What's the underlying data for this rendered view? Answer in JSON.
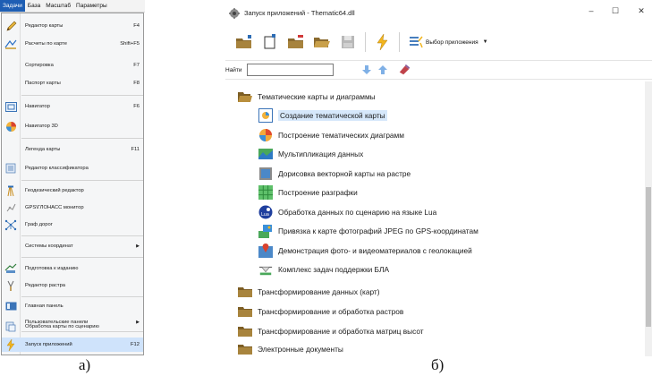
{
  "menu": {
    "menubar": [
      "Задачи",
      "База",
      "Масштаб",
      "Параметры"
    ],
    "items": [
      {
        "label": "Редактор карты",
        "shortcut": "F4",
        "icon": "pencil-icon"
      },
      {
        "label": "Расчеты по карте",
        "shortcut": "Shift+F5",
        "icon": "ruler-icon"
      },
      {
        "label": "Сортировка",
        "shortcut": "F7",
        "icon": ""
      },
      {
        "label": "Паспорт карты",
        "shortcut": "F8",
        "icon": ""
      },
      {
        "label": "Навигатор",
        "shortcut": "F6",
        "icon": "navigator-icon"
      },
      {
        "label": "Навигатор 3D",
        "shortcut": "",
        "icon": "navigator-3d-icon"
      },
      {
        "label": "Легенда карты",
        "shortcut": "F11",
        "icon": ""
      },
      {
        "label": "Редактор классификатора",
        "shortcut": "",
        "icon": "classifier-icon"
      },
      {
        "label": "Геодезический редактор",
        "shortcut": "",
        "icon": "geodesic-icon"
      },
      {
        "label": "GPS\\ГЛОНАСС монитор",
        "shortcut": "",
        "icon": "gps-icon"
      },
      {
        "label": "Граф дорог",
        "shortcut": "",
        "icon": "road-graph-icon"
      },
      {
        "label": "Системы координат",
        "shortcut": "",
        "icon": "",
        "submenu": true
      },
      {
        "label": "Подготовка к изданию",
        "shortcut": "",
        "icon": "print-prep-icon"
      },
      {
        "label": "Редактор растра",
        "shortcut": "",
        "icon": "raster-editor-icon"
      },
      {
        "label": "Главная панель",
        "shortcut": "",
        "icon": "main-panel-icon"
      },
      {
        "label": "Пользовательские панели",
        "shortcut": "",
        "icon": "",
        "submenu": true
      },
      {
        "label": "Обработка карты по сценарию",
        "shortcut": "",
        "icon": "script-icon"
      },
      {
        "label": "Запуск приложений",
        "shortcut": "F12",
        "icon": "lightning-icon",
        "highlighted": true
      }
    ]
  },
  "window": {
    "title": "Запуск приложений - Thematic64.dll",
    "controls": {
      "minimize": "–",
      "maximize": "☐",
      "close": "✕"
    },
    "select_app_label": "Выбор приложения",
    "search_label": "Найти",
    "search_value": "",
    "tree": {
      "groups": [
        {
          "label": "Тематические карты и диаграммы",
          "expanded": true,
          "children": [
            {
              "label": "Создание тематической карты",
              "icon": "thematic-map-icon",
              "selected": true
            },
            {
              "label": "Построение тематических диаграмм",
              "icon": "pie-chart-icon"
            },
            {
              "label": "Мультипликация данных",
              "icon": "animation-icon"
            },
            {
              "label": "Дорисовка векторной карты на растре",
              "icon": "vector-on-raster-icon"
            },
            {
              "label": "Построение разграфки",
              "icon": "grid-icon"
            },
            {
              "label": "Обработка данных по сценарию на языке Lua",
              "icon": "lua-icon"
            },
            {
              "label": "Привязка к карте фотографий JPEG по GPS-координатам",
              "icon": "photo-gps-icon"
            },
            {
              "label": "Демонстрация фото- и видеоматериалов с геолокацией",
              "icon": "media-geo-icon"
            },
            {
              "label": "Комплекс задач поддержки БЛА",
              "icon": "drone-icon"
            }
          ]
        },
        {
          "label": "Трансформирование данных (карт)",
          "expanded": false
        },
        {
          "label": "Трансформирование и обработка растров",
          "expanded": false
        },
        {
          "label": "Трансформирование и обработка матриц высот",
          "expanded": false
        },
        {
          "label": "Электронные документы",
          "expanded": false
        }
      ]
    }
  },
  "captions": {
    "left": "а)",
    "right": "б)"
  },
  "colors": {
    "highlight": "#cfe3fb",
    "selection": "#d6e8fb",
    "folder": "#a07a36",
    "menubar_active": "#1e5eb4"
  }
}
